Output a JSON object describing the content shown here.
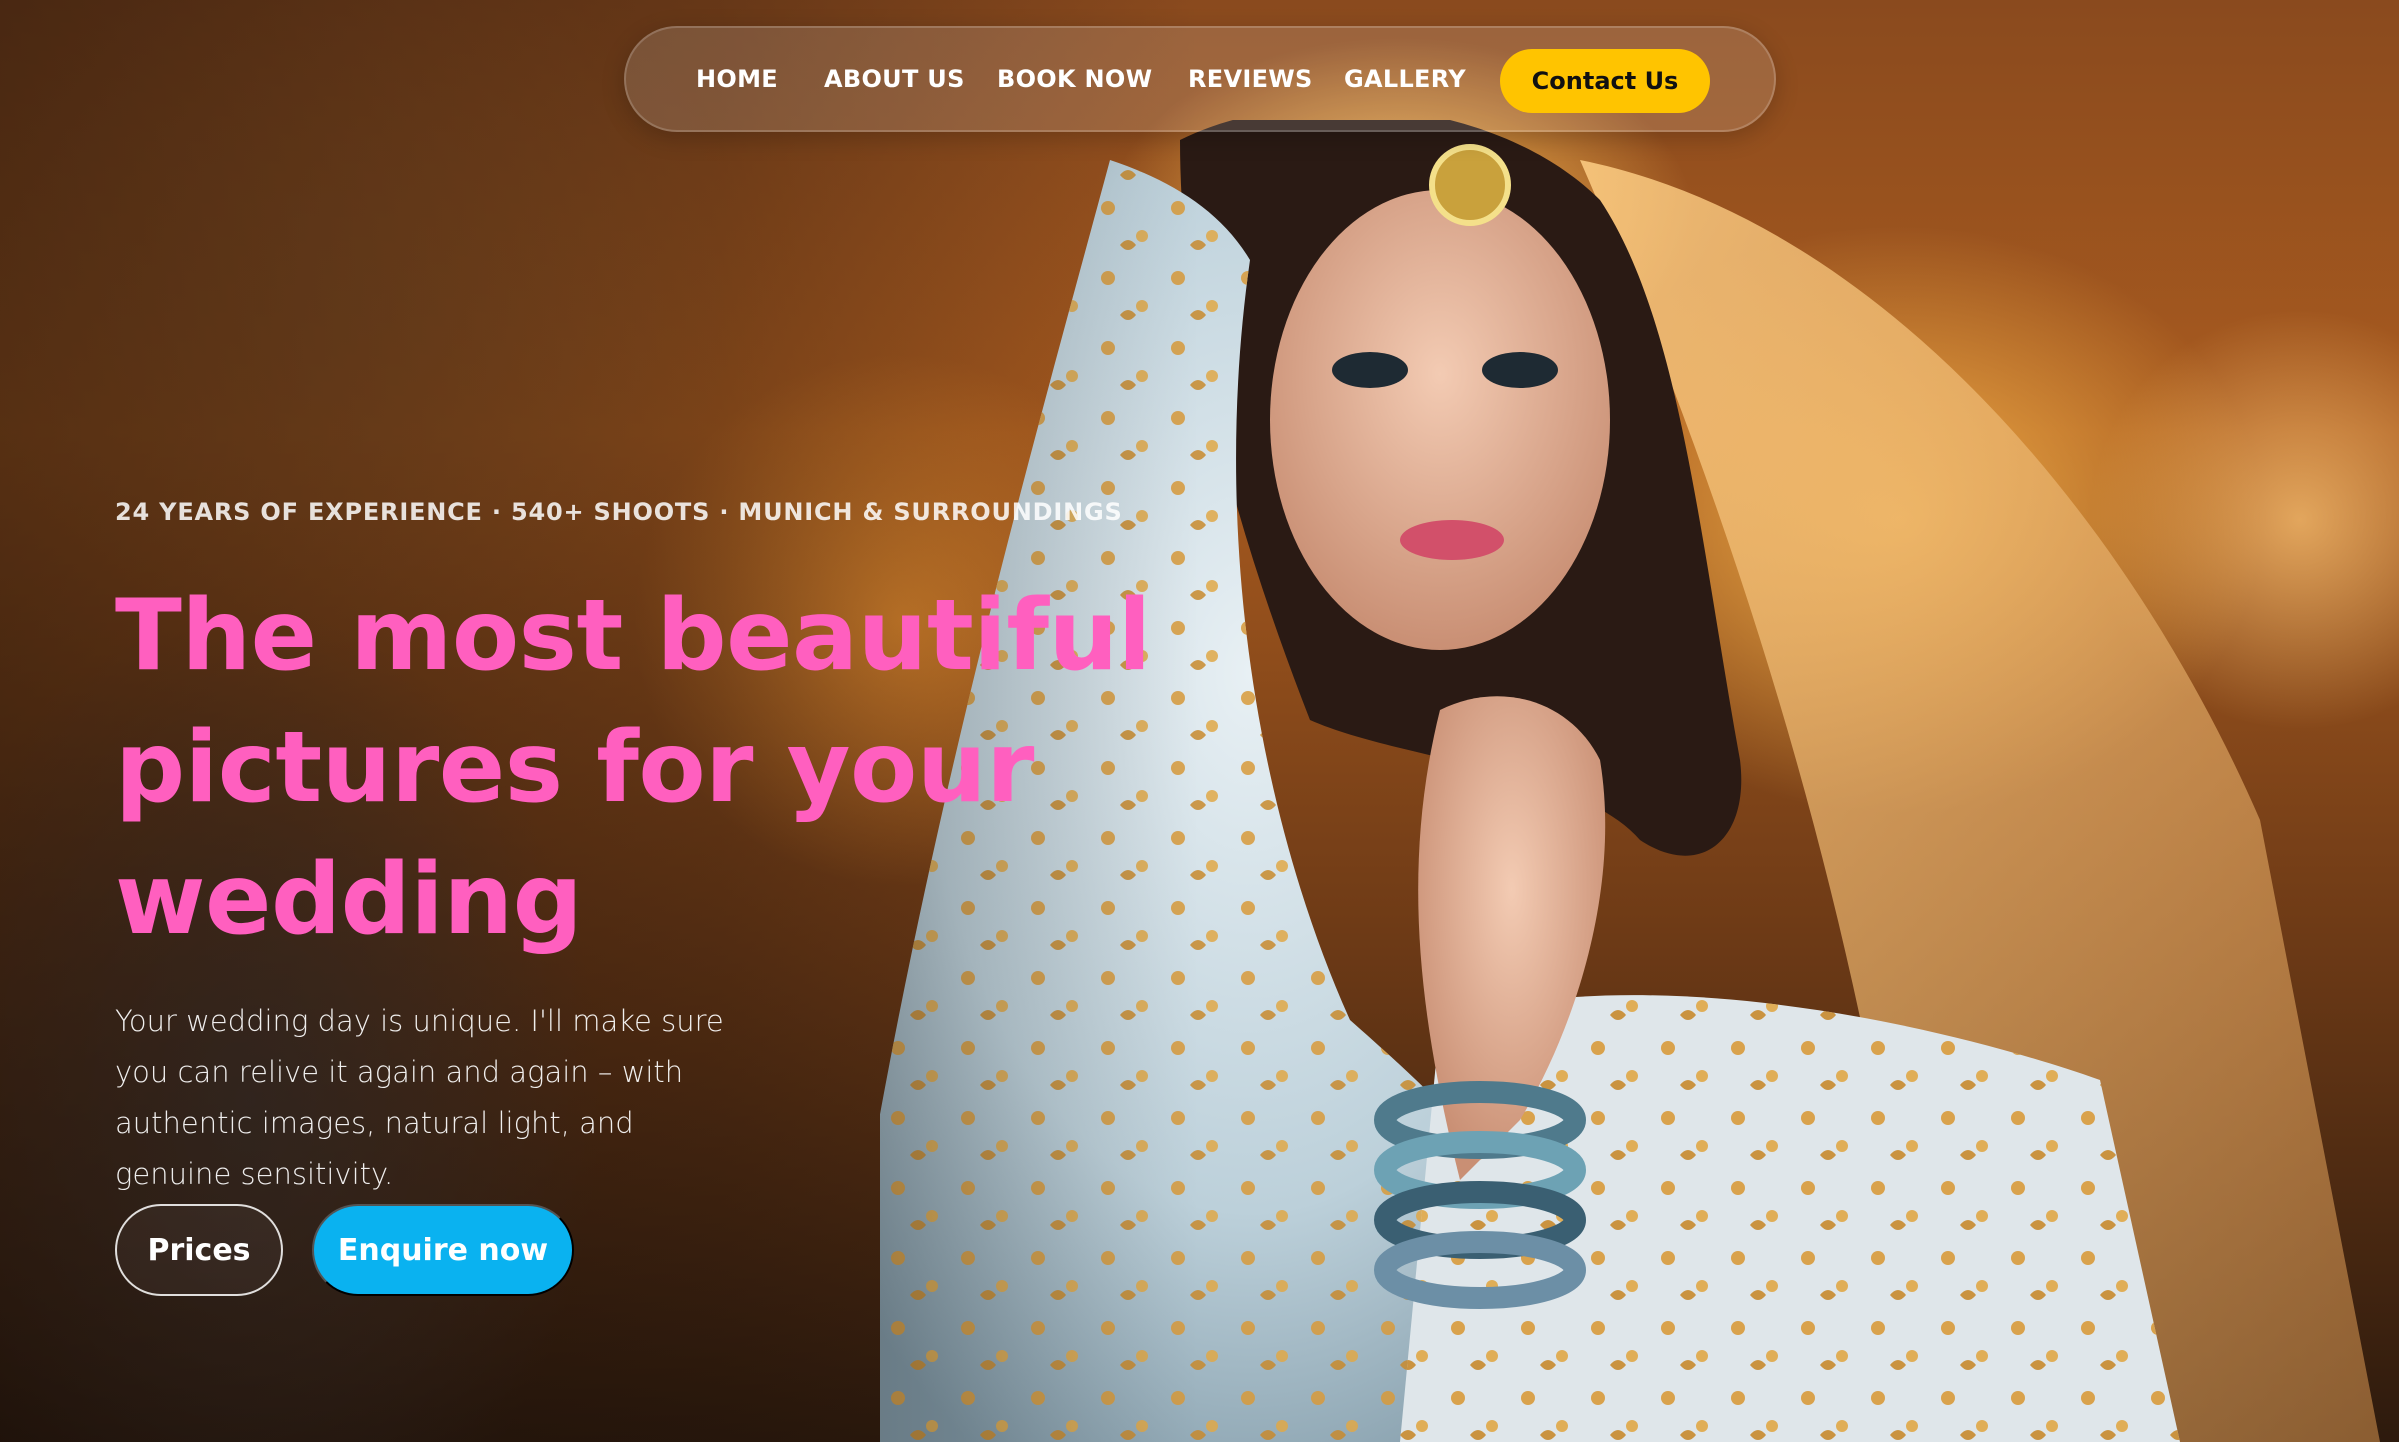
{
  "nav": {
    "items": [
      {
        "label": "HOME"
      },
      {
        "label": "ABOUT US"
      },
      {
        "label": "BOOK NOW"
      },
      {
        "label": "REVIEWS"
      },
      {
        "label": "GALLERY"
      }
    ],
    "contact_label": "Contact Us"
  },
  "hero": {
    "eyebrow": "24 YEARS OF EXPERIENCE · 540+ SHOOTS · MUNICH & SURROUNDINGS",
    "headline": "The most beautiful pictures for your wedding",
    "intro": "Your wedding day is unique. I'll make sure you can relive it again and again – with authentic images, natural light, and genuine sensitivity.",
    "prices_label": "Prices",
    "enquire_label": "Enquire now"
  },
  "colors": {
    "headline": "#ff5fbf",
    "contact_button": "#ffc400",
    "enquire_button": "#0ab2f0"
  }
}
